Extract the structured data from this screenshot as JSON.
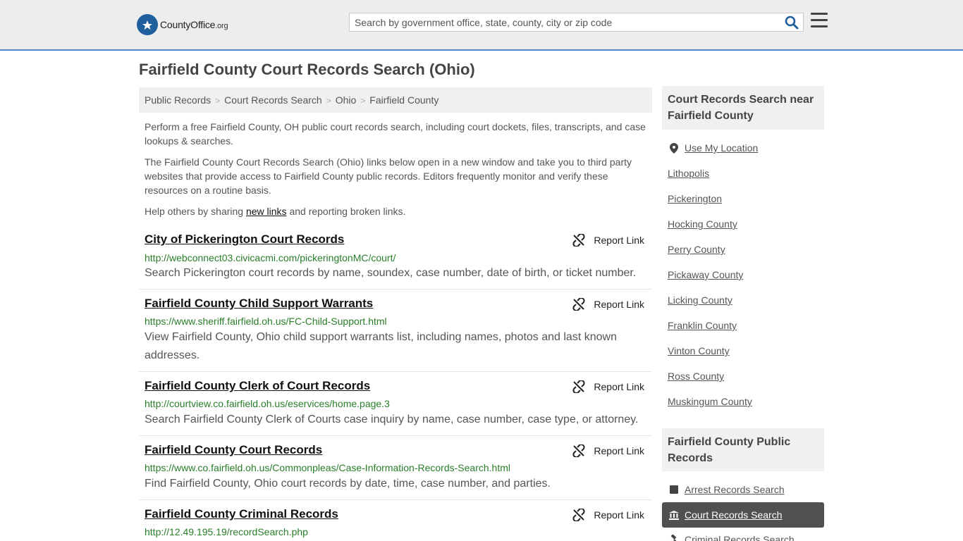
{
  "header": {
    "logo_main": "CountyOffice",
    "logo_tld": ".org",
    "search_placeholder": "Search by government office, state, county, city or zip code"
  },
  "page_title": "Fairfield County Court Records Search (Ohio)",
  "breadcrumb": [
    "Public Records",
    "Court Records Search",
    "Ohio",
    "Fairfield County"
  ],
  "intro": {
    "p1": "Perform a free Fairfield County, OH public court records search, including court dockets, files, transcripts, and case lookups & searches.",
    "p2": "The Fairfield County Court Records Search (Ohio) links below open in a new window and take you to third party websites that provide access to Fairfield County public records. Editors frequently monitor and verify these resources on a routine basis.",
    "p3_before": "Help others by sharing ",
    "p3_link": "new links",
    "p3_after": " and reporting broken links."
  },
  "report_label": "Report Link",
  "results": [
    {
      "title": "City of Pickerington Court Records",
      "url": "http://webconnect03.civicacmi.com/pickeringtonMC/court/",
      "desc": "Search Pickerington court records by name, soundex, case number, date of birth, or ticket number."
    },
    {
      "title": "Fairfield County Child Support Warrants",
      "url": "https://www.sheriff.fairfield.oh.us/FC-Child-Support.html",
      "desc": "View Fairfield County, Ohio child support warrants list, including names, photos and last known addresses."
    },
    {
      "title": "Fairfield County Clerk of Court Records",
      "url": "http://courtview.co.fairfield.oh.us/eservices/home.page.3",
      "desc": "Search Fairfield County Clerk of Courts case inquiry by name, case number, case type, or attorney."
    },
    {
      "title": "Fairfield County Court Records",
      "url": "https://www.co.fairfield.oh.us/Commonpleas/Case-Information-Records-Search.html",
      "desc": "Find Fairfield County, Ohio court records by date, time, case number, and parties."
    },
    {
      "title": "Fairfield County Criminal Records",
      "url": "http://12.49.195.19/recordSearch.php",
      "desc": ""
    }
  ],
  "sidebar": {
    "nearby_heading": "Court Records Search near Fairfield County",
    "use_location": "Use My Location",
    "nearby": [
      "Lithopolis",
      "Pickerington",
      "Hocking County",
      "Perry County",
      "Pickaway County",
      "Licking County",
      "Franklin County",
      "Vinton County",
      "Ross County",
      "Muskingum County"
    ],
    "public_records_heading": "Fairfield County Public Records",
    "records": [
      {
        "label": "Arrest Records Search",
        "icon": "square-icon",
        "active": false
      },
      {
        "label": "Court Records Search",
        "icon": "courthouse-icon",
        "active": true
      },
      {
        "label": "Criminal Records Search",
        "icon": "gavel-icon",
        "active": false
      }
    ]
  },
  "colors": {
    "accent": "#4a86c5",
    "url_green": "#2a7d2a",
    "active_bg": "#505050",
    "logo_blue": "#1f5f9e"
  }
}
